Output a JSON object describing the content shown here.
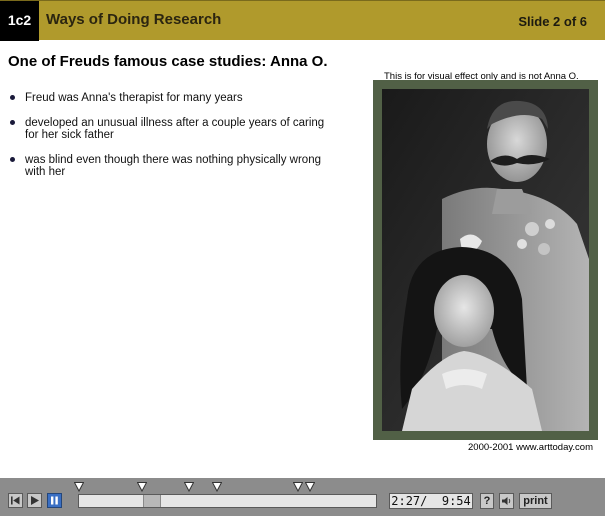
{
  "header": {
    "code": "1c2",
    "title": "Ways of Doing Research",
    "slide_indicator": "Slide 2 of 6"
  },
  "slide": {
    "heading": "One of Freuds famous case studies: Anna O.",
    "bullets": [
      "Freud was Anna's therapist for many years",
      "developed an unusual illness after a couple years of caring for her sick father",
      "was blind even though there was nothing physically wrong with her"
    ],
    "image_caption_top": "This is for visual effect only and is not Anna O.",
    "image_credit": "2000-2001 www.arttoday.com"
  },
  "player": {
    "time_elapsed": "2:27",
    "time_separator": "/",
    "time_total": "9:54",
    "help_label": "?",
    "print_label": "print",
    "marker_count": 6,
    "progress_fraction": 0.248
  },
  "colors": {
    "header_bg": "#b09a2c",
    "player_bg": "#8c8c8c",
    "pause_accent": "#3a6fc4",
    "photo_frame": "#516046"
  },
  "icons": [
    "rewind-icon",
    "play-icon",
    "pause-icon",
    "marker-icon",
    "help-icon",
    "volume-icon"
  ]
}
